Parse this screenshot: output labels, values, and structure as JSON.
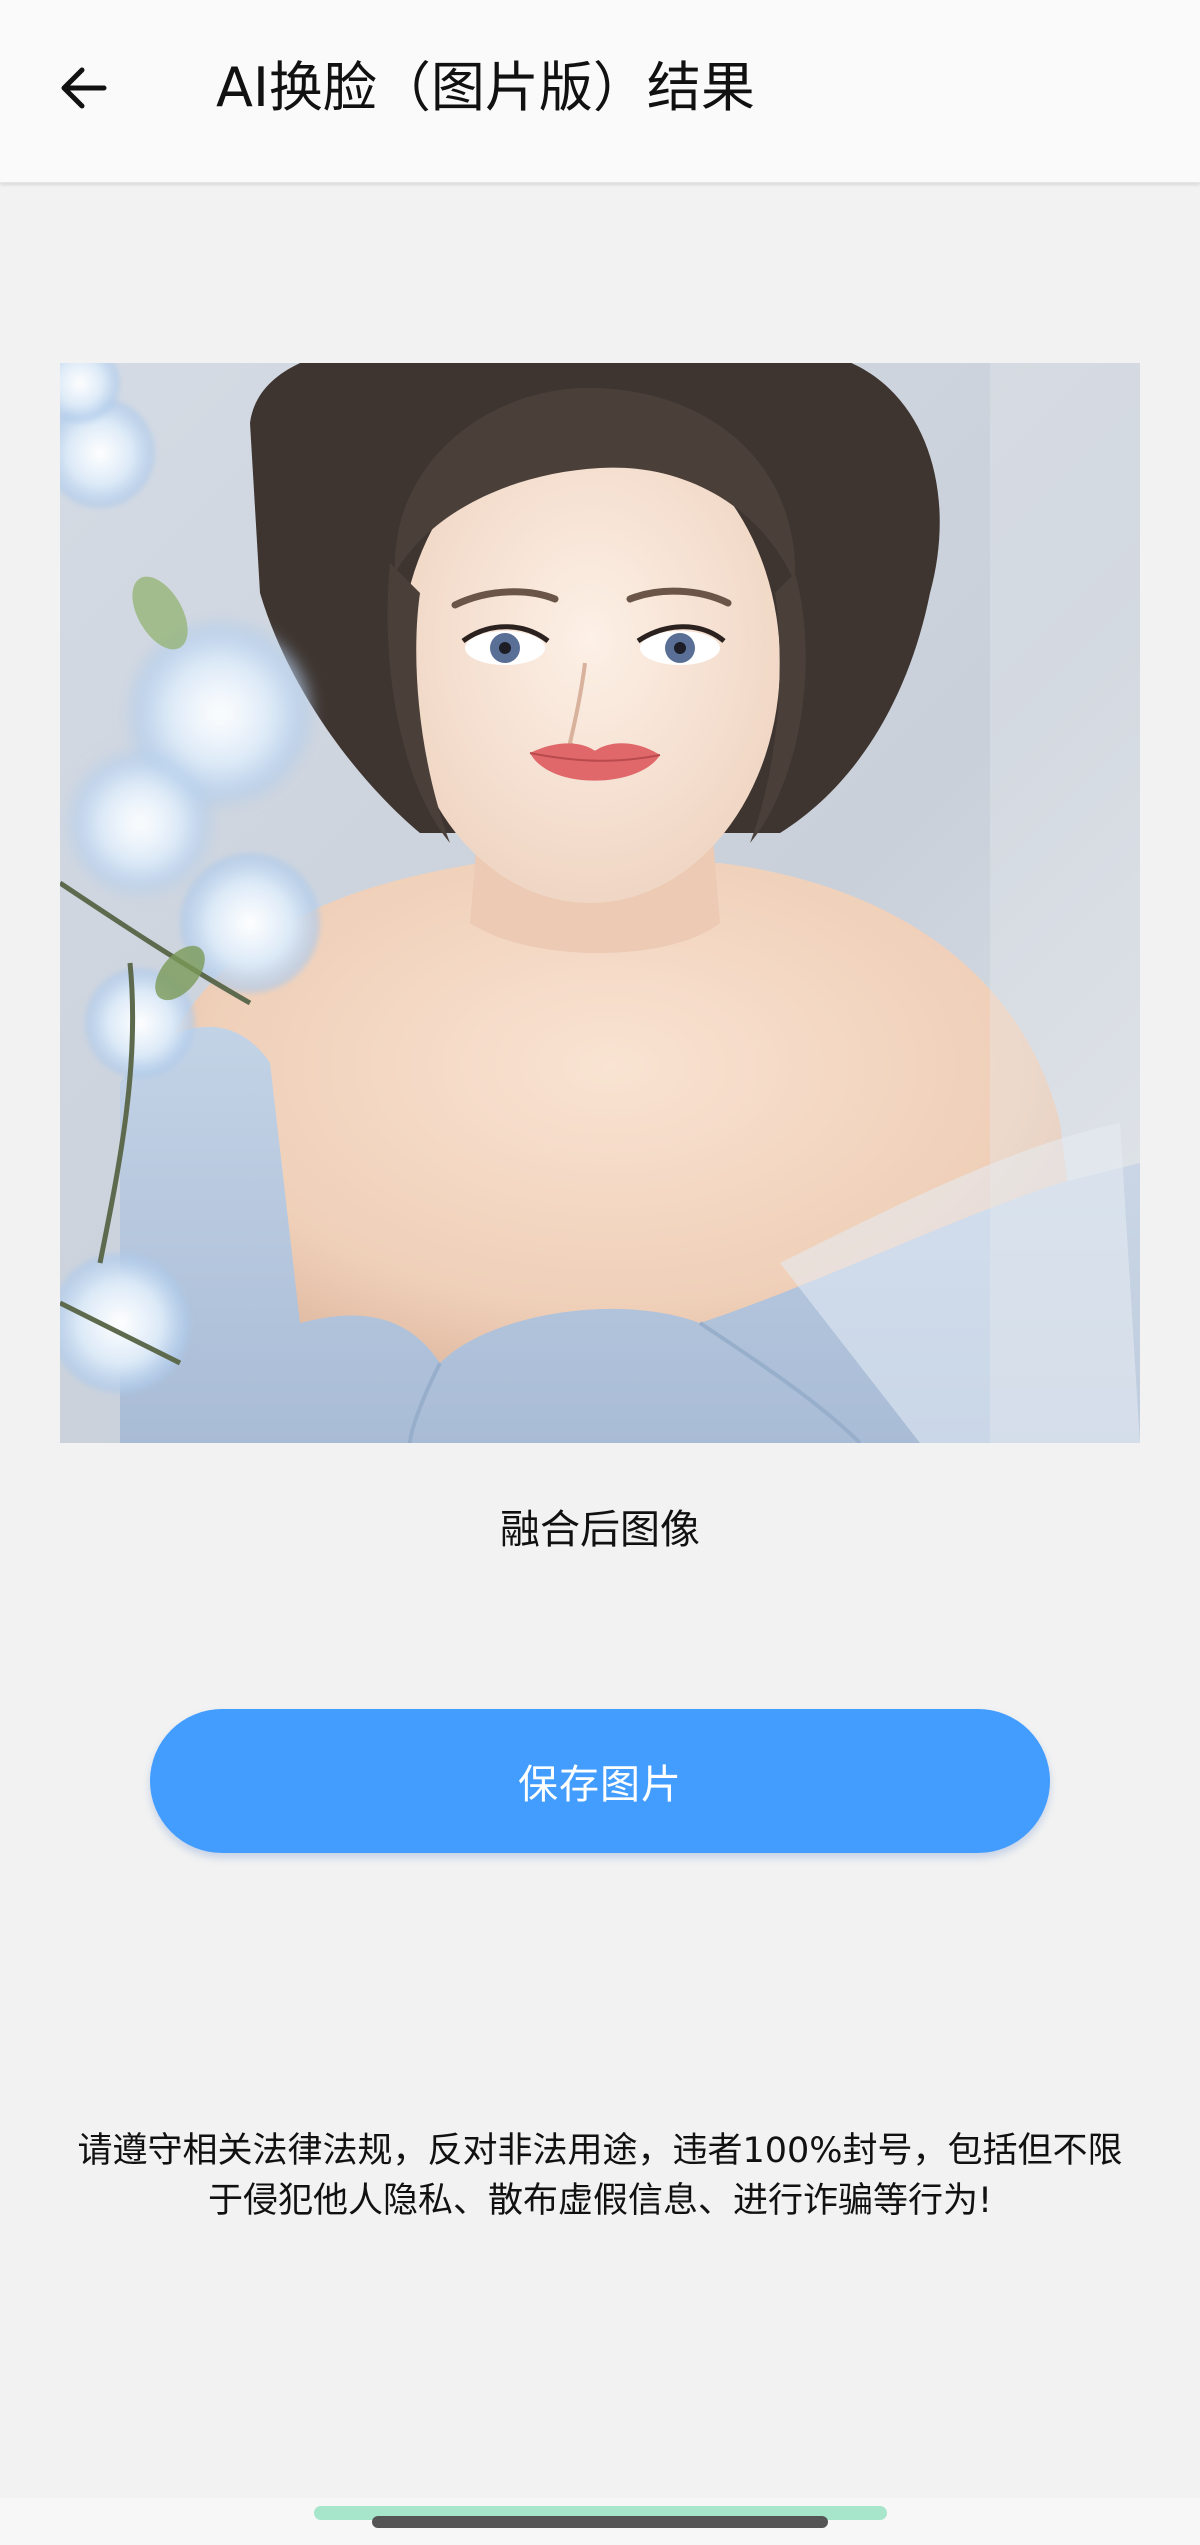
{
  "header": {
    "title": "AI换脸（图片版）结果",
    "back_icon": "arrow-left-icon"
  },
  "result": {
    "image_alt": "融合后图像",
    "caption": "融合后图像"
  },
  "actions": {
    "save_label": "保存图片"
  },
  "notice": {
    "line1": "请遵守相关法律法规，反对非法用途，违者100%封号，包括但不限",
    "line2": "于侵犯他人隐私、散布虚假信息、进行诈骗等行为!"
  },
  "colors": {
    "accent": "#429dff",
    "background": "#f2f2f2",
    "app_bar": "#fafafa",
    "nav_highlight": "#a8e6cc"
  }
}
